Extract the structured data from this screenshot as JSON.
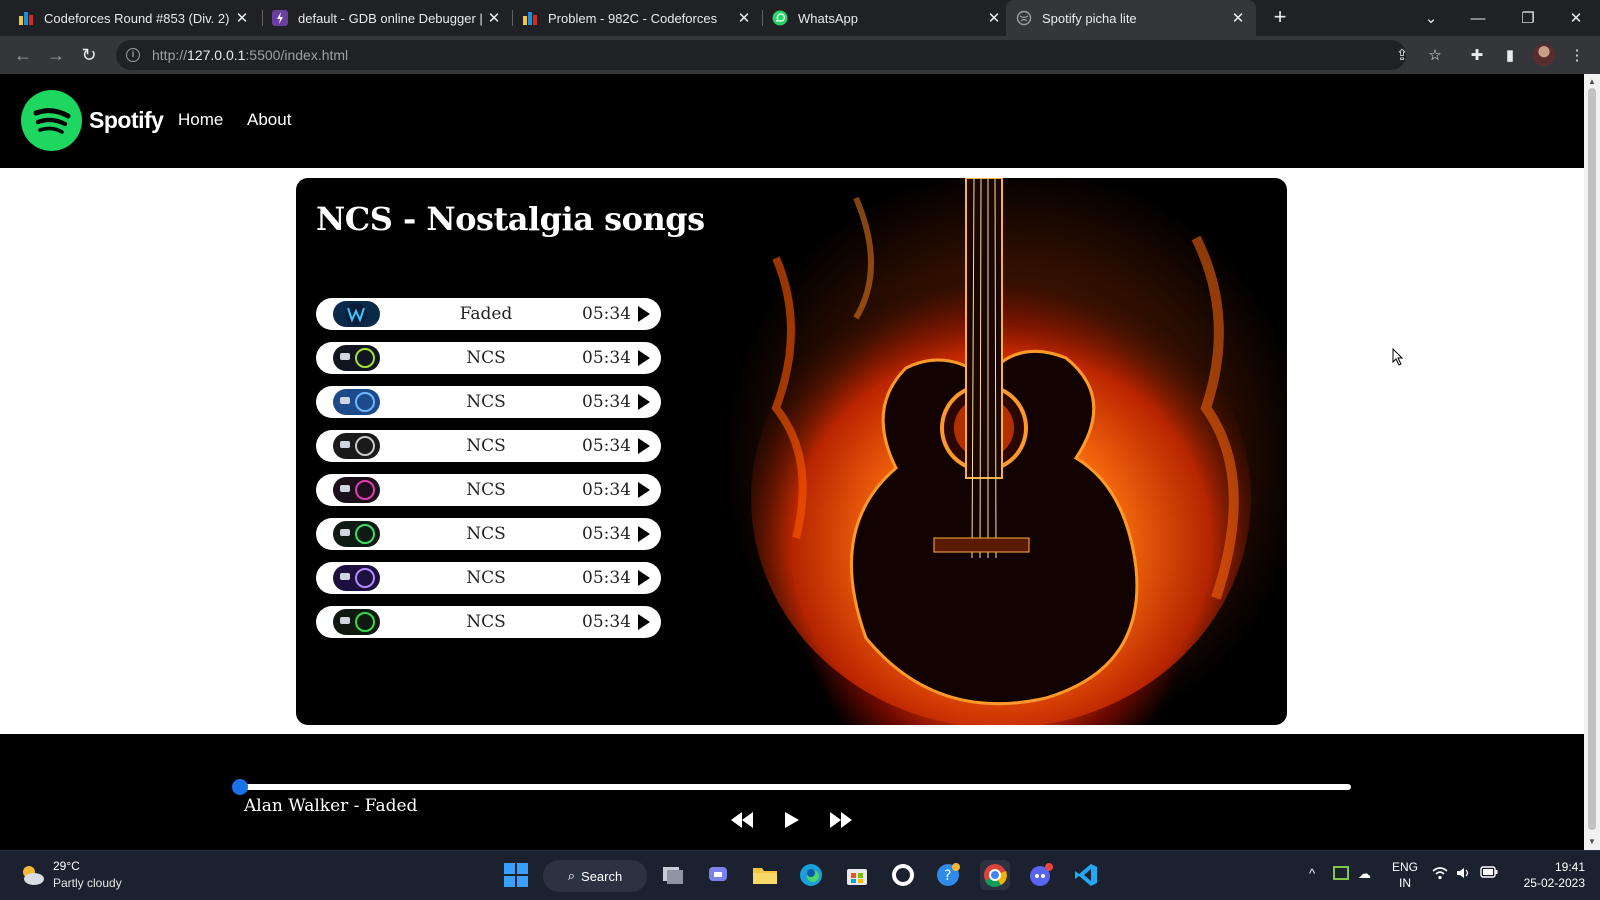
{
  "browser": {
    "tabs": [
      {
        "title": "Codeforces Round #853 (Div. 2)",
        "icon": "codeforces-icon"
      },
      {
        "title": "default - GDB online Debugger |",
        "icon": "gdb-icon"
      },
      {
        "title": "Problem - 982C - Codeforces",
        "icon": "codeforces-icon"
      },
      {
        "title": "WhatsApp",
        "icon": "whatsapp-icon"
      },
      {
        "title": "Spotify picha lite",
        "icon": "globe-icon",
        "active": true
      }
    ],
    "url_prefix": "http://",
    "url_host": "127.0.0.1",
    "url_rest": ":5500/index.html"
  },
  "navbar": {
    "brand": "Spotify",
    "links": [
      "Home",
      "About"
    ]
  },
  "main": {
    "title": "NCS - Nostalgia songs",
    "songs": [
      {
        "name": "Faded",
        "duration": "05:34",
        "cover_color": "#0b2a4a",
        "ring_color": "#38c7ff"
      },
      {
        "name": "NCS",
        "duration": "05:34",
        "cover_color": "#10151f",
        "ring_color": "#a6e22e"
      },
      {
        "name": "NCS",
        "duration": "05:34",
        "cover_color": "#1c4a8a",
        "ring_color": "#6fb6ff"
      },
      {
        "name": "NCS",
        "duration": "05:34",
        "cover_color": "#1a1a1a",
        "ring_color": "#c8c8c8"
      },
      {
        "name": "NCS",
        "duration": "05:34",
        "cover_color": "#1a0f1a",
        "ring_color": "#e23bb0"
      },
      {
        "name": "NCS",
        "duration": "05:34",
        "cover_color": "#0e1a14",
        "ring_color": "#3ddc6c"
      },
      {
        "name": "NCS",
        "duration": "05:34",
        "cover_color": "#1d1040",
        "ring_color": "#b58cff"
      },
      {
        "name": "NCS",
        "duration": "05:34",
        "cover_color": "#0e1a10",
        "ring_color": "#36d94a"
      }
    ]
  },
  "player": {
    "now_playing": "Alan Walker - Faded",
    "progress": 0
  },
  "taskbar": {
    "weather_temp": "29°C",
    "weather_desc": "Partly cloudy",
    "search_label": "Search",
    "lang_line1": "ENG",
    "lang_line2": "IN",
    "time": "19:41",
    "date": "25-02-2023"
  },
  "colors": {
    "accent": "#1ed760",
    "progress_thumb": "#1a73e8",
    "background_dark": "#000000"
  }
}
